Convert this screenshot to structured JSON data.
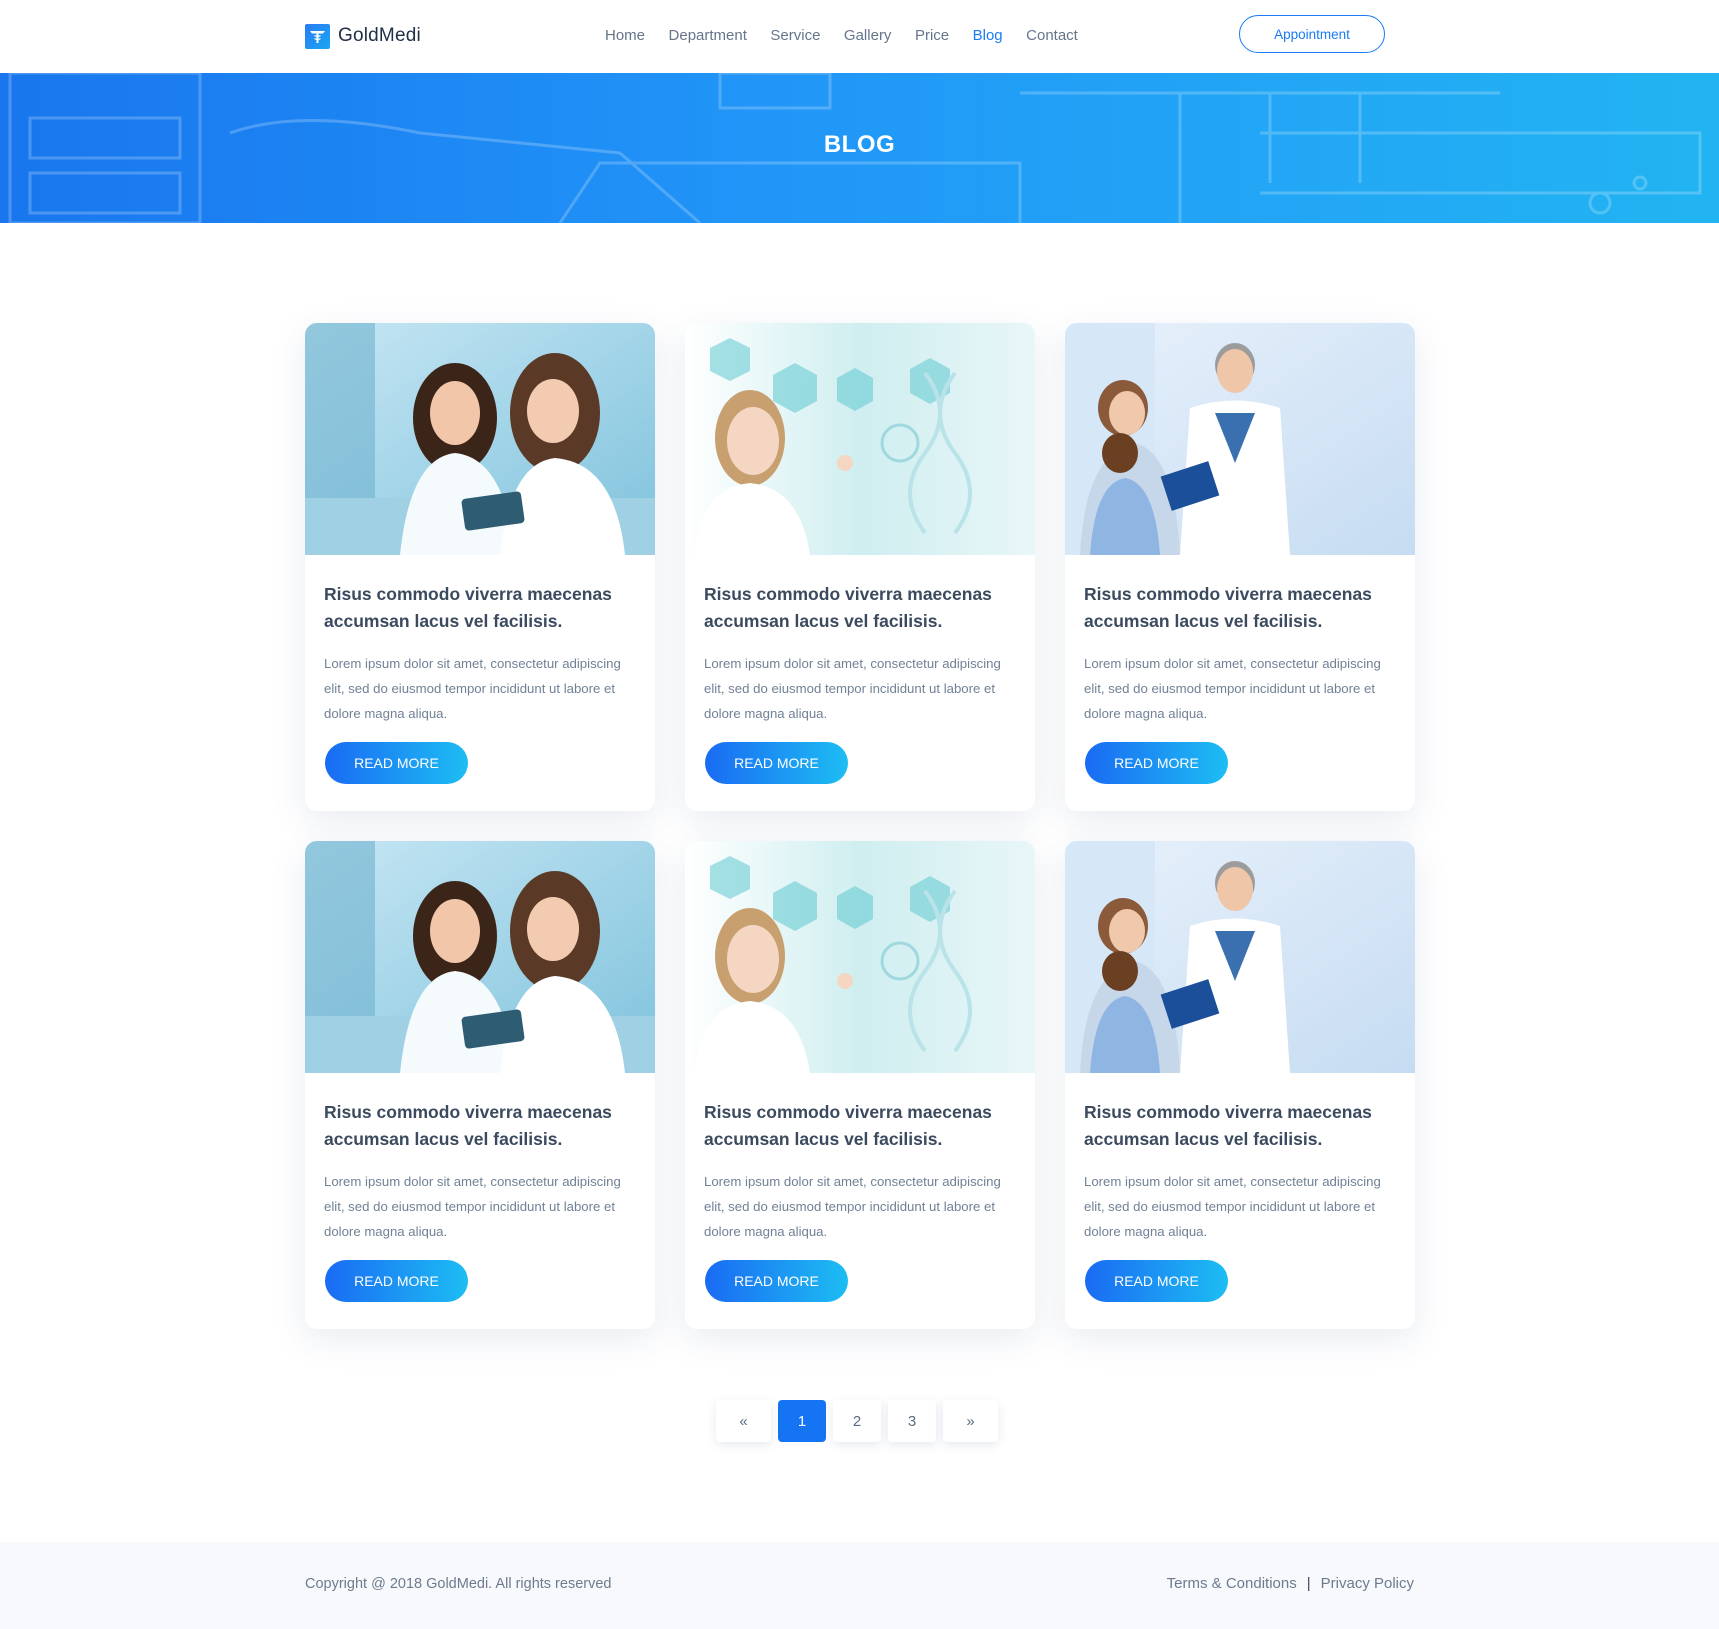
{
  "brand": {
    "name": "GoldMedi",
    "logo_icon": "caduceus-icon"
  },
  "nav": {
    "items": [
      {
        "label": "Home",
        "active": false
      },
      {
        "label": "Department",
        "active": false
      },
      {
        "label": "Service",
        "active": false
      },
      {
        "label": "Gallery",
        "active": false
      },
      {
        "label": "Price",
        "active": false
      },
      {
        "label": "Blog",
        "active": true
      },
      {
        "label": "Contact",
        "active": false
      }
    ],
    "appointment_label": "Appointment"
  },
  "banner": {
    "title": "BLOG"
  },
  "posts": [
    {
      "image": "doctors-with-tablet",
      "title": "Risus commodo viverra maecenas accumsan lacus vel facilisis.",
      "excerpt": "Lorem ipsum dolor sit amet, consectetur adipiscing elit, sed do eiusmod tempor incididunt ut labore et dolore magna aliqua.",
      "cta": "READ MORE"
    },
    {
      "image": "doctor-digital-dna",
      "title": "Risus commodo viverra maecenas accumsan lacus vel facilisis.",
      "excerpt": "Lorem ipsum dolor sit amet, consectetur adipiscing elit, sed do eiusmod tempor incididunt ut labore et dolore magna aliqua.",
      "cta": "READ MORE"
    },
    {
      "image": "doctor-with-family",
      "title": "Risus commodo viverra maecenas accumsan lacus vel facilisis.",
      "excerpt": "Lorem ipsum dolor sit amet, consectetur adipiscing elit, sed do eiusmod tempor incididunt ut labore et dolore magna aliqua.",
      "cta": "READ MORE"
    },
    {
      "image": "doctors-with-tablet",
      "title": "Risus commodo viverra maecenas accumsan lacus vel facilisis.",
      "excerpt": "Lorem ipsum dolor sit amet, consectetur adipiscing elit, sed do eiusmod tempor incididunt ut labore et dolore magna aliqua.",
      "cta": "READ MORE"
    },
    {
      "image": "doctor-digital-dna",
      "title": "Risus commodo viverra maecenas accumsan lacus vel facilisis.",
      "excerpt": "Lorem ipsum dolor sit amet, consectetur adipiscing elit, sed do eiusmod tempor incididunt ut labore et dolore magna aliqua.",
      "cta": "READ MORE"
    },
    {
      "image": "doctor-with-family",
      "title": "Risus commodo viverra maecenas accumsan lacus vel facilisis.",
      "excerpt": "Lorem ipsum dolor sit amet, consectetur adipiscing elit, sed do eiusmod tempor incididunt ut labore et dolore magna aliqua.",
      "cta": "READ MORE"
    }
  ],
  "pagination": {
    "prev": "«",
    "pages": [
      "1",
      "2",
      "3"
    ],
    "current": "1",
    "next": "»"
  },
  "footer": {
    "copyright": "Copyright @ 2018 GoldMedi. All rights reserved",
    "terms": "Terms & Conditions",
    "separator": "|",
    "privacy": "Privacy Policy"
  },
  "colors": {
    "accent": "#1b7cf5",
    "gradient_start": "#1a6bf3",
    "gradient_end": "#1dbdf3",
    "footer_bg": "#f7f9fd"
  }
}
